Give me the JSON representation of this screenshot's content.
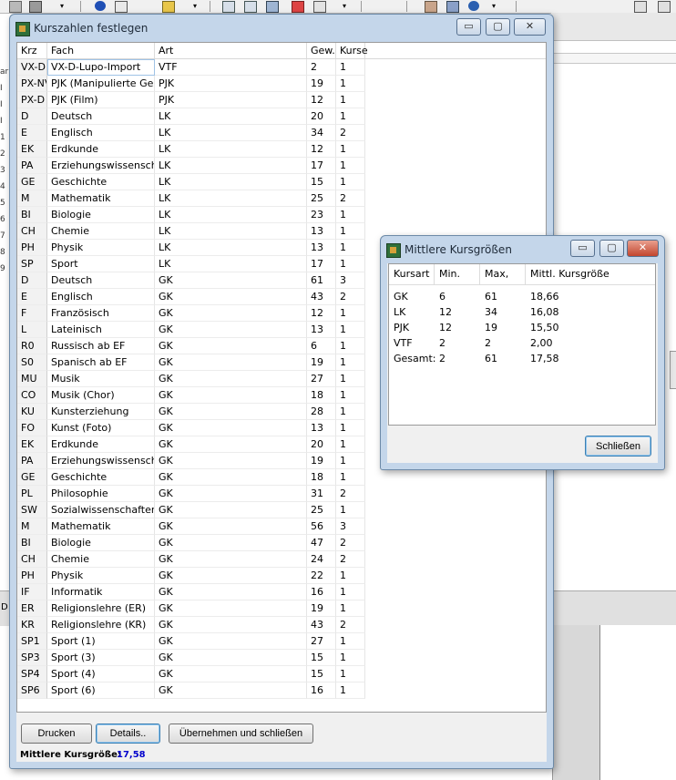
{
  "main_window": {
    "title": "Kurszahlen festlegen",
    "columns": [
      "Krz",
      "Fach",
      "Art",
      "Gew.",
      "Kurse"
    ],
    "rows": [
      {
        "krz": "VX-D",
        "fach": "VX-D-Lupo-Import",
        "art": "VTF",
        "gew": "2",
        "kurse": "1"
      },
      {
        "krz": "PX-NV",
        "fach": "PJK (Manipulierte Gesundheit)",
        "art": "PJK",
        "gew": "19",
        "kurse": "1"
      },
      {
        "krz": "PX-D",
        "fach": "PJK (Film)",
        "art": "PJK",
        "gew": "12",
        "kurse": "1"
      },
      {
        "krz": "D",
        "fach": "Deutsch",
        "art": "LK",
        "gew": "20",
        "kurse": "1"
      },
      {
        "krz": "E",
        "fach": "Englisch",
        "art": "LK",
        "gew": "34",
        "kurse": "2"
      },
      {
        "krz": "EK",
        "fach": "Erdkunde",
        "art": "LK",
        "gew": "12",
        "kurse": "1"
      },
      {
        "krz": "PA",
        "fach": "Erziehungswissenschaften",
        "art": "LK",
        "gew": "17",
        "kurse": "1"
      },
      {
        "krz": "GE",
        "fach": "Geschichte",
        "art": "LK",
        "gew": "15",
        "kurse": "1"
      },
      {
        "krz": "M",
        "fach": "Mathematik",
        "art": "LK",
        "gew": "25",
        "kurse": "2"
      },
      {
        "krz": "BI",
        "fach": "Biologie",
        "art": "LK",
        "gew": "23",
        "kurse": "1"
      },
      {
        "krz": "CH",
        "fach": "Chemie",
        "art": "LK",
        "gew": "13",
        "kurse": "1"
      },
      {
        "krz": "PH",
        "fach": "Physik",
        "art": "LK",
        "gew": "13",
        "kurse": "1"
      },
      {
        "krz": "SP",
        "fach": "Sport",
        "art": "LK",
        "gew": "17",
        "kurse": "1"
      },
      {
        "krz": "D",
        "fach": "Deutsch",
        "art": "GK",
        "gew": "61",
        "kurse": "3"
      },
      {
        "krz": "E",
        "fach": "Englisch",
        "art": "GK",
        "gew": "43",
        "kurse": "2"
      },
      {
        "krz": "F",
        "fach": "Französisch",
        "art": "GK",
        "gew": "12",
        "kurse": "1"
      },
      {
        "krz": "L",
        "fach": "Lateinisch",
        "art": "GK",
        "gew": "13",
        "kurse": "1"
      },
      {
        "krz": "R0",
        "fach": "Russisch ab EF",
        "art": "GK",
        "gew": "6",
        "kurse": "1"
      },
      {
        "krz": "S0",
        "fach": "Spanisch ab EF",
        "art": "GK",
        "gew": "19",
        "kurse": "1"
      },
      {
        "krz": "MU",
        "fach": "Musik",
        "art": "GK",
        "gew": "27",
        "kurse": "1"
      },
      {
        "krz": "CO",
        "fach": "Musik (Chor)",
        "art": "GK",
        "gew": "18",
        "kurse": "1"
      },
      {
        "krz": "KU",
        "fach": "Kunsterziehung",
        "art": "GK",
        "gew": "28",
        "kurse": "1"
      },
      {
        "krz": "FO",
        "fach": "Kunst (Foto)",
        "art": "GK",
        "gew": "13",
        "kurse": "1"
      },
      {
        "krz": "EK",
        "fach": "Erdkunde",
        "art": "GK",
        "gew": "20",
        "kurse": "1"
      },
      {
        "krz": "PA",
        "fach": "Erziehungswissenschaften",
        "art": "GK",
        "gew": "19",
        "kurse": "1"
      },
      {
        "krz": "GE",
        "fach": "Geschichte",
        "art": "GK",
        "gew": "18",
        "kurse": "1"
      },
      {
        "krz": "PL",
        "fach": "Philosophie",
        "art": "GK",
        "gew": "31",
        "kurse": "2"
      },
      {
        "krz": "SW",
        "fach": "Sozialwissenschaften",
        "art": "GK",
        "gew": "25",
        "kurse": "1"
      },
      {
        "krz": "M",
        "fach": "Mathematik",
        "art": "GK",
        "gew": "56",
        "kurse": "3"
      },
      {
        "krz": "BI",
        "fach": "Biologie",
        "art": "GK",
        "gew": "47",
        "kurse": "2"
      },
      {
        "krz": "CH",
        "fach": "Chemie",
        "art": "GK",
        "gew": "24",
        "kurse": "2"
      },
      {
        "krz": "PH",
        "fach": "Physik",
        "art": "GK",
        "gew": "22",
        "kurse": "1"
      },
      {
        "krz": "IF",
        "fach": "Informatik",
        "art": "GK",
        "gew": "16",
        "kurse": "1"
      },
      {
        "krz": "ER",
        "fach": "Religionslehre (ER)",
        "art": "GK",
        "gew": "19",
        "kurse": "1"
      },
      {
        "krz": "KR",
        "fach": "Religionslehre (KR)",
        "art": "GK",
        "gew": "43",
        "kurse": "2"
      },
      {
        "krz": "SP1",
        "fach": "Sport (1)",
        "art": "GK",
        "gew": "27",
        "kurse": "1"
      },
      {
        "krz": "SP3",
        "fach": "Sport (3)",
        "art": "GK",
        "gew": "15",
        "kurse": "1"
      },
      {
        "krz": "SP4",
        "fach": "Sport (4)",
        "art": "GK",
        "gew": "15",
        "kurse": "1"
      },
      {
        "krz": "SP6",
        "fach": "Sport (6)",
        "art": "GK",
        "gew": "16",
        "kurse": "1"
      }
    ],
    "buttons": {
      "print": "Drucken",
      "details": "Details..",
      "apply_close": "Übernehmen und schließen"
    },
    "average_label": "Mittlere Kursgröße:",
    "average_value": "17,58"
  },
  "dialog": {
    "title": "Mittlere Kursgrößen",
    "columns": [
      "Kursart",
      "Min.",
      "Max,",
      "Mittl. Kursgröße"
    ],
    "rows": [
      {
        "kursart": "GK",
        "min": "6",
        "max": "61",
        "mittl": "18,66"
      },
      {
        "kursart": "LK",
        "min": "12",
        "max": "34",
        "mittl": "16,08"
      },
      {
        "kursart": "PJK",
        "min": "12",
        "max": "19",
        "mittl": "15,50"
      },
      {
        "kursart": "VTF",
        "min": "2",
        "max": "2",
        "mittl": "2,00"
      },
      {
        "kursart": "Gesamt:",
        "min": "2",
        "max": "61",
        "mittl": "17,58"
      }
    ],
    "close_button": "Schließen"
  },
  "caption_buttons": {
    "minimize": "▭",
    "maximize": "▢",
    "close": "✕"
  },
  "background_app": {
    "left_edge_labels": [
      "ar",
      "I",
      "I",
      "I",
      "1",
      "2",
      "3",
      "4",
      "5",
      "6",
      "7",
      "8",
      "9"
    ],
    "bottom_left_label": "D"
  },
  "colors": {
    "title_bar": "#c4d6ea",
    "highlight_value": "#0000cc",
    "close_button": "#c2452e"
  }
}
